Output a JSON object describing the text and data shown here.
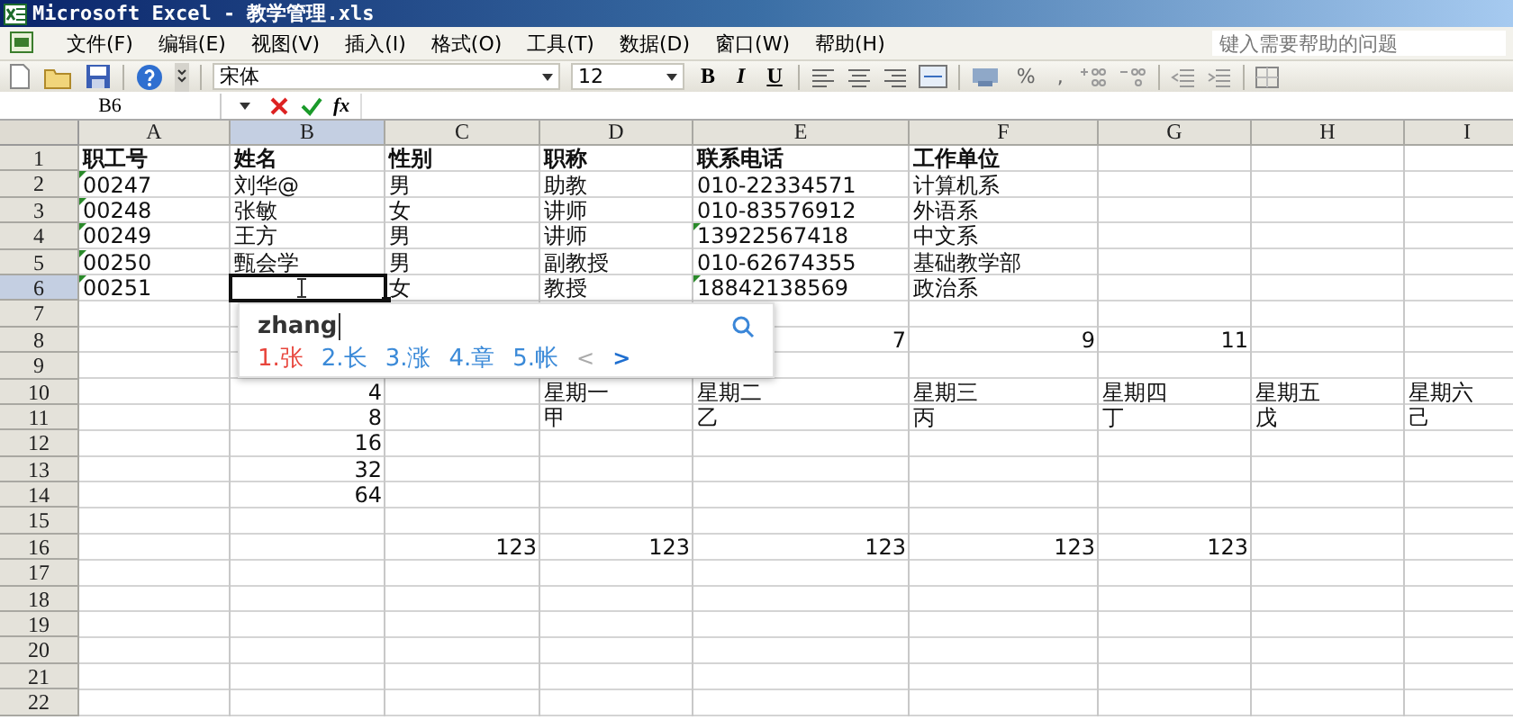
{
  "window": {
    "title": "Microsoft Excel - 教学管理.xls"
  },
  "menu": [
    "文件(F)",
    "编辑(E)",
    "视图(V)",
    "插入(I)",
    "格式(O)",
    "工具(T)",
    "数据(D)",
    "窗口(W)",
    "帮助(H)"
  ],
  "help_search": {
    "placeholder": "键入需要帮助的问题"
  },
  "toolbar": {
    "font": "宋体",
    "size": "12",
    "bold": "B",
    "italic": "I",
    "underline": "U",
    "percent": "%",
    "comma": ","
  },
  "formula_bar": {
    "name_box": "B6",
    "function_label": "fx"
  },
  "columns": [
    {
      "label": "A",
      "selected": false
    },
    {
      "label": "B",
      "selected": true
    },
    {
      "label": "C",
      "selected": false
    },
    {
      "label": "D",
      "selected": false
    },
    {
      "label": "E",
      "selected": false
    },
    {
      "label": "F",
      "selected": false
    },
    {
      "label": "G",
      "selected": false
    },
    {
      "label": "H",
      "selected": false
    },
    {
      "label": "I",
      "selected": false
    }
  ],
  "rows": [
    {
      "label": "1",
      "selected": false,
      "kind": "heading",
      "cells": {
        "A": {
          "text": "职工号",
          "kind": "text",
          "flag": false
        },
        "B": {
          "text": "姓名",
          "kind": "text",
          "flag": false
        },
        "C": {
          "text": "性别",
          "kind": "text",
          "flag": false
        },
        "D": {
          "text": "职称",
          "kind": "text",
          "flag": false
        },
        "E": {
          "text": "联系电话",
          "kind": "text",
          "flag": false
        },
        "F": {
          "text": "工作单位",
          "kind": "text",
          "flag": false
        }
      }
    },
    {
      "label": "2",
      "selected": false,
      "kind": "data",
      "cells": {
        "A": {
          "text": "00247",
          "kind": "text",
          "flag": true
        },
        "B": {
          "text": "刘华@",
          "kind": "text",
          "flag": false
        },
        "C": {
          "text": "男",
          "kind": "text",
          "flag": false
        },
        "D": {
          "text": "助教",
          "kind": "text",
          "flag": false
        },
        "E": {
          "text": "010-22334571",
          "kind": "text",
          "flag": false
        },
        "F": {
          "text": "计算机系",
          "kind": "text",
          "flag": false
        }
      }
    },
    {
      "label": "3",
      "selected": false,
      "kind": "data",
      "cells": {
        "A": {
          "text": "00248",
          "kind": "text",
          "flag": true
        },
        "B": {
          "text": "张敏",
          "kind": "text",
          "flag": false
        },
        "C": {
          "text": "女",
          "kind": "text",
          "flag": false
        },
        "D": {
          "text": "讲师",
          "kind": "text",
          "flag": false
        },
        "E": {
          "text": "010-83576912",
          "kind": "text",
          "flag": false
        },
        "F": {
          "text": "外语系",
          "kind": "text",
          "flag": false
        }
      }
    },
    {
      "label": "4",
      "selected": false,
      "kind": "data",
      "cells": {
        "A": {
          "text": "00249",
          "kind": "text",
          "flag": true
        },
        "B": {
          "text": "王方",
          "kind": "text",
          "flag": false
        },
        "C": {
          "text": "男",
          "kind": "text",
          "flag": false
        },
        "D": {
          "text": "讲师",
          "kind": "text",
          "flag": false
        },
        "E": {
          "text": "13922567418",
          "kind": "text",
          "flag": true
        },
        "F": {
          "text": "中文系",
          "kind": "text",
          "flag": false
        }
      }
    },
    {
      "label": "5",
      "selected": false,
      "kind": "data",
      "cells": {
        "A": {
          "text": "00250",
          "kind": "text",
          "flag": true
        },
        "B": {
          "text": "甄会学",
          "kind": "text",
          "flag": false
        },
        "C": {
          "text": "男",
          "kind": "text",
          "flag": false
        },
        "D": {
          "text": "副教授",
          "kind": "text",
          "flag": false
        },
        "E": {
          "text": "010-62674355",
          "kind": "text",
          "flag": false
        },
        "F": {
          "text": "基础教学部",
          "kind": "text",
          "flag": false
        }
      }
    },
    {
      "label": "6",
      "selected": true,
      "kind": "data",
      "cells": {
        "A": {
          "text": "00251",
          "kind": "text",
          "flag": true
        },
        "C": {
          "text": "女",
          "kind": "text",
          "flag": false
        },
        "D": {
          "text": "教授",
          "kind": "text",
          "flag": false
        },
        "E": {
          "text": "18842138569",
          "kind": "text",
          "flag": true
        },
        "F": {
          "text": "政治系",
          "kind": "text",
          "flag": false
        }
      }
    },
    {
      "label": "7",
      "selected": false,
      "kind": "data"
    },
    {
      "label": "8",
      "selected": false,
      "kind": "data",
      "cells": {
        "E": {
          "text": "7",
          "kind": "number",
          "flag": false
        },
        "F": {
          "text": "9",
          "kind": "number",
          "flag": false
        },
        "G": {
          "text": "11",
          "kind": "number",
          "flag": false
        }
      }
    },
    {
      "label": "9",
      "selected": false,
      "kind": "data"
    },
    {
      "label": "10",
      "selected": false,
      "kind": "data",
      "cells": {
        "B": {
          "text": "4",
          "kind": "number",
          "flag": false
        },
        "D": {
          "text": "星期一",
          "kind": "text",
          "flag": false
        },
        "E": {
          "text": "星期二",
          "kind": "text",
          "flag": false
        },
        "F": {
          "text": "星期三",
          "kind": "text",
          "flag": false
        },
        "G": {
          "text": "星期四",
          "kind": "text",
          "flag": false
        },
        "H": {
          "text": "星期五",
          "kind": "text",
          "flag": false
        },
        "I": {
          "text": "星期六",
          "kind": "text",
          "flag": false
        }
      }
    },
    {
      "label": "11",
      "selected": false,
      "kind": "data",
      "cells": {
        "B": {
          "text": "8",
          "kind": "number",
          "flag": false
        },
        "D": {
          "text": "甲",
          "kind": "text",
          "flag": false
        },
        "E": {
          "text": "乙",
          "kind": "text",
          "flag": false
        },
        "F": {
          "text": "丙",
          "kind": "text",
          "flag": false
        },
        "G": {
          "text": "丁",
          "kind": "text",
          "flag": false
        },
        "H": {
          "text": "戊",
          "kind": "text",
          "flag": false
        },
        "I": {
          "text": "己",
          "kind": "text",
          "flag": false
        }
      }
    },
    {
      "label": "12",
      "selected": false,
      "kind": "data",
      "cells": {
        "B": {
          "text": "16",
          "kind": "number",
          "flag": false
        }
      }
    },
    {
      "label": "13",
      "selected": false,
      "kind": "data",
      "cells": {
        "B": {
          "text": "32",
          "kind": "number",
          "flag": false
        }
      }
    },
    {
      "label": "14",
      "selected": false,
      "kind": "data",
      "cells": {
        "B": {
          "text": "64",
          "kind": "number",
          "flag": false
        }
      }
    },
    {
      "label": "15",
      "selected": false,
      "kind": "data"
    },
    {
      "label": "16",
      "selected": false,
      "kind": "data",
      "cells": {
        "C": {
          "text": "123",
          "kind": "number",
          "flag": false
        },
        "D": {
          "text": "123",
          "kind": "number",
          "flag": false
        },
        "E": {
          "text": "123",
          "kind": "number",
          "flag": false
        },
        "F": {
          "text": "123",
          "kind": "number",
          "flag": false
        },
        "G": {
          "text": "123",
          "kind": "number",
          "flag": false
        }
      }
    },
    {
      "label": "17",
      "selected": false,
      "kind": "data"
    },
    {
      "label": "18",
      "selected": false,
      "kind": "data"
    },
    {
      "label": "19",
      "selected": false,
      "kind": "data"
    },
    {
      "label": "20",
      "selected": false,
      "kind": "data"
    },
    {
      "label": "21",
      "selected": false,
      "kind": "data"
    },
    {
      "label": "22",
      "selected": false,
      "kind": "data"
    }
  ],
  "ime": {
    "value": "zhang",
    "candidates": [
      {
        "label": "1.张",
        "selected": true
      },
      {
        "label": "2.长",
        "selected": false
      },
      {
        "label": "3.涨",
        "selected": false
      },
      {
        "label": "4.章",
        "selected": false
      },
      {
        "label": "5.帐",
        "selected": false
      }
    ],
    "prev": {
      "label": "<",
      "disabled": true
    },
    "next": {
      "label": ">",
      "disabled": false
    }
  }
}
